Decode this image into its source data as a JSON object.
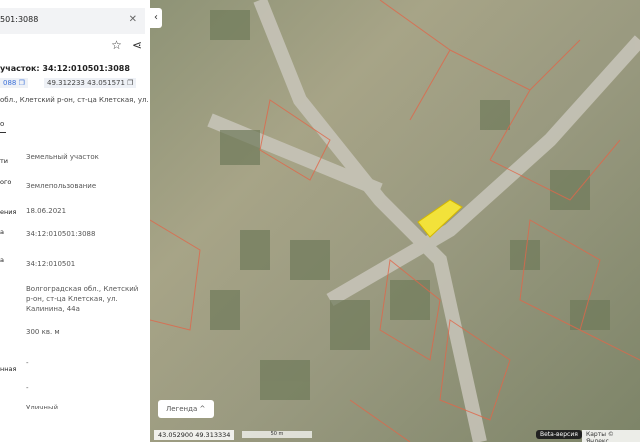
{
  "search": {
    "value": "501:3088"
  },
  "header": {
    "title": "участок: 34:12:010501:3088",
    "chip1": "088",
    "chip2": "49.312233 43.051571",
    "address": "обл., Клетский р-он, ст-ца Клетская, ул.",
    "tab": "о"
  },
  "fields": [
    {
      "label": "ти",
      "value": "Земельный участок"
    },
    {
      "label": "ого",
      "value": "Землепользование"
    },
    {
      "label": "ения",
      "value": "18.06.2021"
    },
    {
      "label": "а",
      "value": "34:12:010501:3088"
    },
    {
      "label": "а",
      "value": "34:12:010501"
    },
    {
      "label": "",
      "value": "Волгоградская обл., Клетский р-он, ст-ца Клетская, ул. Калинина, 44а"
    },
    {
      "label": "",
      "value": "300 кв. м"
    },
    {
      "label": "нная",
      "value": "-"
    },
    {
      "label": "",
      "value": "-"
    },
    {
      "label": "",
      "value": "Уличный"
    }
  ],
  "map": {
    "legend": "Легенда ^",
    "coords": "43.052900  49.313334",
    "scale": "50 m",
    "beta": "Beta-версия",
    "copyright": "Карты © Яндекс",
    "highlight_color": "#f2e23a",
    "parcel_color": "#e0674a"
  }
}
